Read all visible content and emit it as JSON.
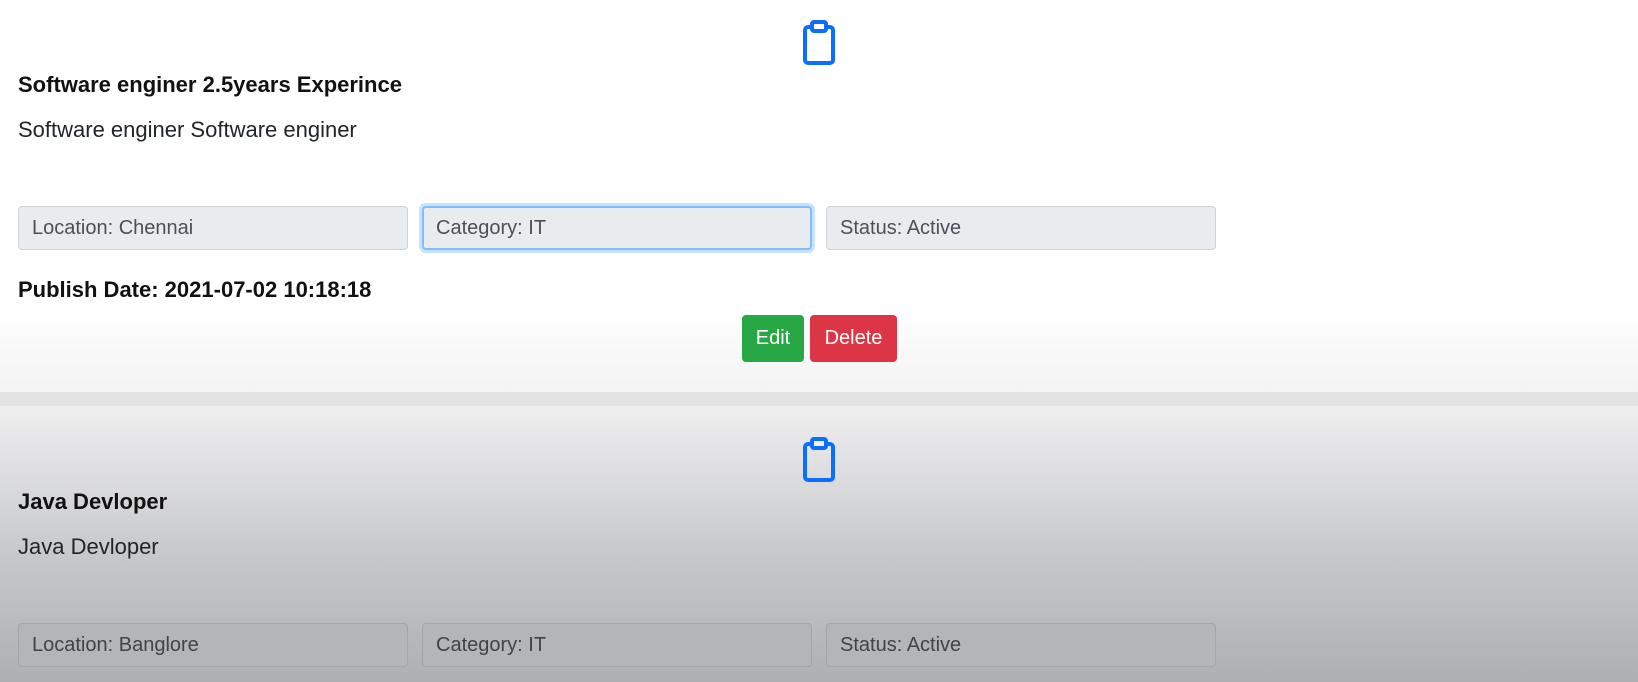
{
  "jobs": [
    {
      "icon": "clipboard-icon",
      "title": "Software enginer 2.5years Experince",
      "description": "Software enginer Software enginer",
      "location": "Location: Chennai",
      "category": "Category: IT",
      "status": "Status: Active",
      "publish_date": "Publish Date: 2021-07-02 10:18:18",
      "edit_label": "Edit",
      "delete_label": "Delete"
    },
    {
      "icon": "clipboard-icon",
      "title": "Java Devloper",
      "description": "Java Devloper",
      "location": "Location: Banglore",
      "category": "Category: IT",
      "status": "Status: Active"
    }
  ],
  "colors": {
    "icon_blue": "#0d6efd",
    "edit_green": "#28a745",
    "delete_red": "#dc3545",
    "field_bg": "#e9ecef",
    "focus_border": "#80bdff"
  }
}
